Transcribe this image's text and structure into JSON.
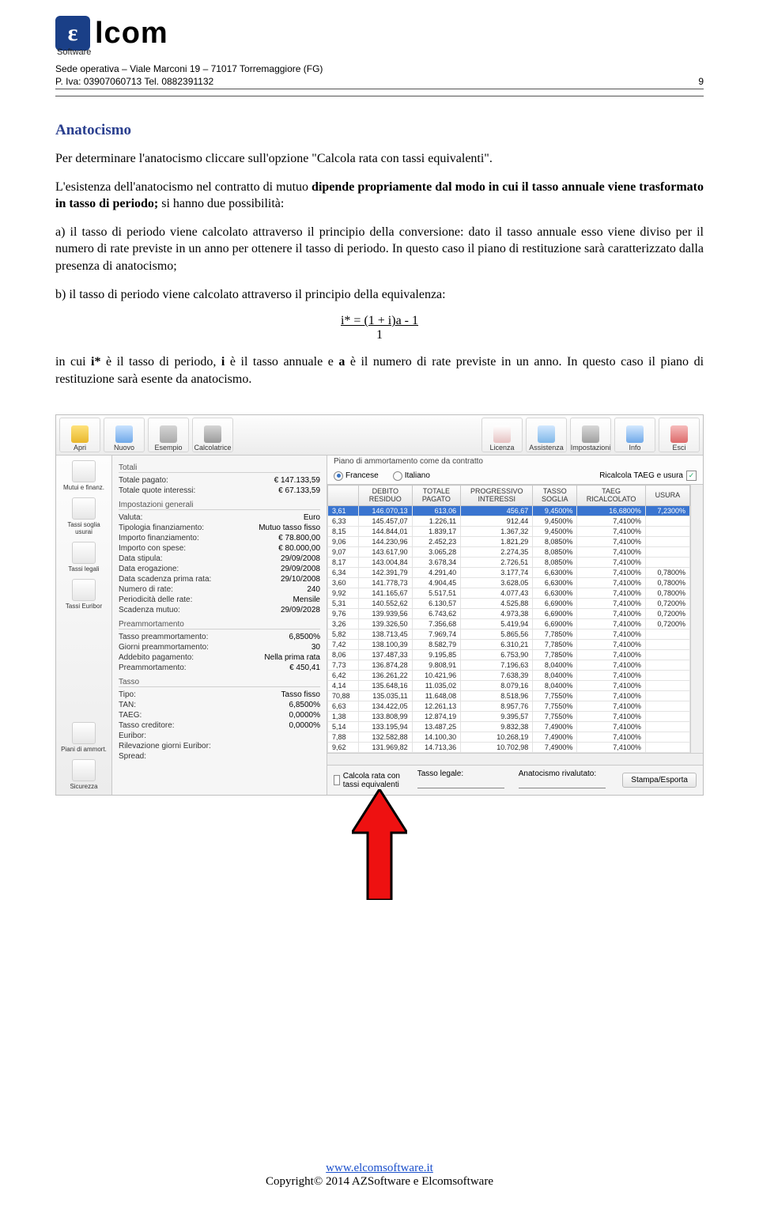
{
  "header": {
    "logo_letter": "ε",
    "logo_word": "lcom",
    "software_label": "Software",
    "address_line": "Sede operativa – Viale Marconi 19 – 71017 Torremaggiore (FG)",
    "piva_line": "P. Iva: 03907060713 Tel. 0882391132",
    "page_number": "9"
  },
  "doc": {
    "title": "Anatocismo",
    "p1": "Per determinare l'anatocismo cliccare sull'opzione \"Calcola rata con tassi equivalenti\".",
    "p2_a": "L'esistenza dell'anatocismo nel contratto di mutuo ",
    "p2_b_bold": "dipende propriamente dal modo in cui il tasso annuale viene trasformato in tasso di periodo;",
    "p2_c": " si hanno due possibilità:",
    "p3": "a) il tasso di periodo viene calcolato attraverso il principio della conversione: dato il tasso annuale esso viene diviso per il numero di rate previste in un anno per ottenere il tasso di periodo. In questo caso il piano di restituzione sarà caratterizzato dalla presenza di anatocismo;",
    "p4": "b) il tasso di periodo viene calcolato attraverso il principio della equivalenza:",
    "formula_num": "i* = (1 + i)a - 1",
    "formula_den": "1",
    "p5_a": "in cui ",
    "p5_b": "i*",
    "p5_c": " è il tasso di periodo, ",
    "p5_d": "i",
    "p5_e": " è il tasso annuale e ",
    "p5_f": "a",
    "p5_g": " è il numero di rate previste in un anno. In questo caso il piano di restituzione sarà esente da anatocismo."
  },
  "app": {
    "toolbar_left": [
      "Apri",
      "Nuovo",
      "Esempio",
      "Calcolatrice"
    ],
    "toolbar_right": [
      "Licenza",
      "Assistenza",
      "Impostazioni",
      "Info",
      "Esci"
    ],
    "nav": [
      "Mutui e finanz.",
      "Tassi soglia usurai",
      "Tassi legali",
      "Tassi Euribor",
      "Piani di ammort.",
      "Sicurezza"
    ],
    "form": {
      "totali_label": "Totali",
      "totale_pagato_lbl": "Totale pagato:",
      "totale_pagato_val": "€ 147.133,59",
      "totale_quote_lbl": "Totale quote interessi:",
      "totale_quote_val": "€ 67.133,59",
      "imp_gen": "Impostazioni generali",
      "valuta_lbl": "Valuta:",
      "valuta_val": "Euro",
      "tipofin_lbl": "Tipologia finanziamento:",
      "tipofin_val": "Mutuo tasso fisso",
      "impfin_lbl": "Importo finanziamento:",
      "impfin_val": "€ 78.800,00",
      "impspese_lbl": "Importo con spese:",
      "impspese_val": "€ 80.000,00",
      "datastip_lbl": "Data stipula:",
      "datastip_val": "29/09/2008",
      "dataerog_lbl": "Data erogazione:",
      "dataerog_val": "29/09/2008",
      "datascad_lbl": "Data scadenza prima rata:",
      "datascad_val": "29/10/2008",
      "numrate_lbl": "Numero di rate:",
      "numrate_val": "240",
      "period_lbl": "Periodicità delle rate:",
      "period_val": "Mensile",
      "scadmutuo_lbl": "Scadenza mutuo:",
      "scadmutuo_val": "29/09/2028",
      "preamm": "Preammortamento",
      "tassopre_lbl": "Tasso preammortamento:",
      "tassopre_val": "6,8500%",
      "giornipre_lbl": "Giorni preammortamento:",
      "giornipre_val": "30",
      "addebito_lbl": "Addebito pagamento:",
      "addebito_val": "Nella prima rata",
      "preamm_lbl": "Preammortamento:",
      "preamm_val": "€ 450,41",
      "tasso": "Tasso",
      "tipo_lbl": "Tipo:",
      "tipo_val": "Tasso fisso",
      "tan_lbl": "TAN:",
      "tan_val": "6,8500%",
      "taeg_lbl": "TAEG:",
      "taeg_val": "0,0000%",
      "tcred_lbl": "Tasso creditore:",
      "tcred_val": "0,0000%",
      "eur_lbl": "Euribor:",
      "eur_val": "",
      "ril_lbl": "Rilevazione giorni Euribor:",
      "ril_val": "",
      "spread_lbl": "Spread:",
      "spread_val": ""
    },
    "main": {
      "caption": "Piano di ammortamento come da contratto",
      "radio_fr": "Francese",
      "radio_it": "Italiano",
      "ricalc_lbl": "Ricalcola TAEG e usura",
      "headers": [
        "",
        "DEBITO\nRESIDUO",
        "TOTALE\nPAGATO",
        "PROGRESSIVO\nINTERESSI",
        "TASSO\nSOGLIA",
        "TAEG\nRICALCOLATO",
        "USURA"
      ],
      "rows": [
        [
          "3,61",
          "146.070,13",
          "613,06",
          "456,67",
          "9,4500%",
          "16,6800%",
          "7,2300%"
        ],
        [
          "6,33",
          "145.457,07",
          "1.226,11",
          "912,44",
          "9,4500%",
          "7,4100%",
          ""
        ],
        [
          "8,15",
          "144.844,01",
          "1.839,17",
          "1.367,32",
          "9,4500%",
          "7,4100%",
          ""
        ],
        [
          "9,06",
          "144.230,96",
          "2.452,23",
          "1.821,29",
          "8,0850%",
          "7,4100%",
          ""
        ],
        [
          "9,07",
          "143.617,90",
          "3.065,28",
          "2.274,35",
          "8,0850%",
          "7,4100%",
          ""
        ],
        [
          "8,17",
          "143.004,84",
          "3.678,34",
          "2.726,51",
          "8,0850%",
          "7,4100%",
          ""
        ],
        [
          "6,34",
          "142.391,79",
          "4.291,40",
          "3.177,74",
          "6,6300%",
          "7,4100%",
          "0,7800%"
        ],
        [
          "3,60",
          "141.778,73",
          "4.904,45",
          "3.628,05",
          "6,6300%",
          "7,4100%",
          "0,7800%"
        ],
        [
          "9,92",
          "141.165,67",
          "5.517,51",
          "4.077,43",
          "6,6300%",
          "7,4100%",
          "0,7800%"
        ],
        [
          "5,31",
          "140.552,62",
          "6.130,57",
          "4.525,88",
          "6,6900%",
          "7,4100%",
          "0,7200%"
        ],
        [
          "9,76",
          "139.939,56",
          "6.743,62",
          "4.973,38",
          "6,6900%",
          "7,4100%",
          "0,7200%"
        ],
        [
          "3,26",
          "139.326,50",
          "7.356,68",
          "5.419,94",
          "6,6900%",
          "7,4100%",
          "0,7200%"
        ],
        [
          "5,82",
          "138.713,45",
          "7.969,74",
          "5.865,56",
          "7,7850%",
          "7,4100%",
          ""
        ],
        [
          "7,42",
          "138.100,39",
          "8.582,79",
          "6.310,21",
          "7,7850%",
          "7,4100%",
          ""
        ],
        [
          "8,06",
          "137.487,33",
          "9.195,85",
          "6.753,90",
          "7,7850%",
          "7,4100%",
          ""
        ],
        [
          "7,73",
          "136.874,28",
          "9.808,91",
          "7.196,63",
          "8,0400%",
          "7,4100%",
          ""
        ],
        [
          "6,42",
          "136.261,22",
          "10.421,96",
          "7.638,39",
          "8,0400%",
          "7,4100%",
          ""
        ],
        [
          "4,14",
          "135.648,16",
          "11.035,02",
          "8.079,16",
          "8,0400%",
          "7,4100%",
          ""
        ],
        [
          "70,88",
          "135.035,11",
          "11.648,08",
          "8.518,96",
          "7,7550%",
          "7,4100%",
          ""
        ],
        [
          "6,63",
          "134.422,05",
          "12.261,13",
          "8.957,76",
          "7,7550%",
          "7,4100%",
          ""
        ],
        [
          "1,38",
          "133.808,99",
          "12.874,19",
          "9.395,57",
          "7,7550%",
          "7,4100%",
          ""
        ],
        [
          "5,14",
          "133.195,94",
          "13.487,25",
          "9.832,38",
          "7,4900%",
          "7,4100%",
          ""
        ],
        [
          "7,88",
          "132.582,88",
          "14.100,30",
          "10.268,19",
          "7,4900%",
          "7,4100%",
          ""
        ],
        [
          "9,62",
          "131.969,82",
          "14.713,36",
          "10.702,98",
          "7,4900%",
          "7,4100%",
          ""
        ]
      ],
      "calc_eq_lbl": "Calcola rata con tassi equivalenti",
      "tasso_legale_lbl": "Tasso legale:",
      "anatocismo_lbl": "Anatocismo rivalutato:",
      "stampa_lbl": "Stampa/Esporta"
    }
  },
  "footer": {
    "link": "www.elcomsoftware.it",
    "copyright": "Copyright© 2014 AZSoftware e Elcomsoftware"
  }
}
